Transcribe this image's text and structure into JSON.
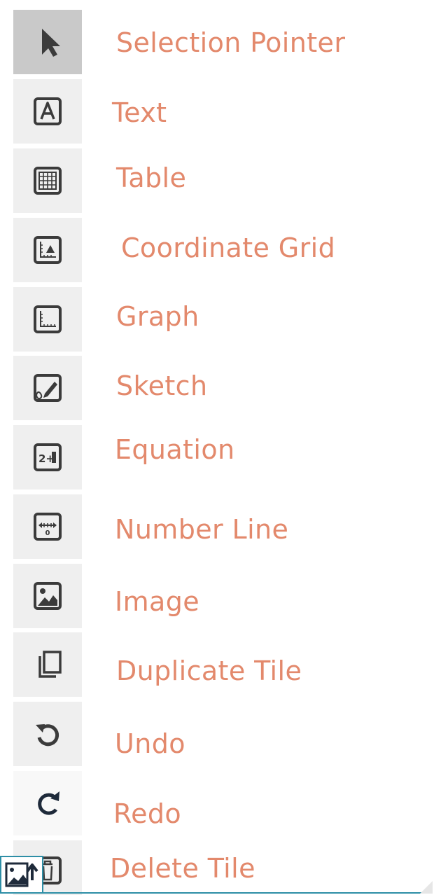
{
  "colors": {
    "label": "#e3896c",
    "icon": "#3b3b3b",
    "redo_icon": "#1e2a3a",
    "corner_border": "#2d8ea6"
  },
  "tools": [
    {
      "label": "Selection Pointer",
      "icon": "pointer-icon",
      "selected": true
    },
    {
      "label": "Text",
      "icon": "text-icon"
    },
    {
      "label": "Table",
      "icon": "table-icon"
    },
    {
      "label": "Coordinate Grid",
      "icon": "coordinate-grid-icon"
    },
    {
      "label": "Graph",
      "icon": "graph-icon"
    },
    {
      "label": "Sketch",
      "icon": "sketch-icon"
    },
    {
      "label": "Equation",
      "icon": "equation-icon",
      "icon_text": "2+"
    },
    {
      "label": "Number Line",
      "icon": "number-line-icon",
      "icon_text": "0"
    },
    {
      "label": "Image",
      "icon": "image-icon"
    },
    {
      "label": "Duplicate Tile",
      "icon": "duplicate-icon"
    },
    {
      "label": "Undo",
      "icon": "undo-icon"
    },
    {
      "label": "Redo",
      "icon": "redo-icon"
    },
    {
      "label": "Delete Tile",
      "icon": "delete-icon"
    }
  ],
  "corner_icon": "image-upload-icon"
}
